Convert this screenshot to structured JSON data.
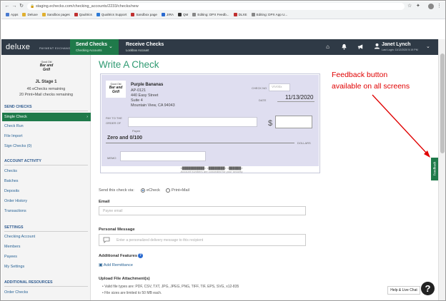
{
  "browser": {
    "url": "staging.echecks.com/checking_accounts/2233/checks/new",
    "bookmarks": [
      {
        "label": "Apps",
        "color": "#4a7bd0"
      },
      {
        "label": "Deluxe",
        "color": "#e0b030"
      },
      {
        "label": "Sandbox pages",
        "color": "#e0b030"
      },
      {
        "label": "Qaultrics",
        "color": "#c03030"
      },
      {
        "label": "Qualtrics Support",
        "color": "#2d7ad6"
      },
      {
        "label": "Sandbox page",
        "color": "#c03030"
      },
      {
        "label": "JIRA",
        "color": "#2a6ad0"
      },
      {
        "label": "QM",
        "color": "#333333"
      },
      {
        "label": "Editing: DPX Feedb...",
        "color": "#888888"
      },
      {
        "label": "DLXE",
        "color": "#c03030"
      },
      {
        "label": "Editing: DPX App U...",
        "color": "#888888"
      }
    ]
  },
  "header": {
    "logo": "deluxe",
    "logo_sub": "PAYMENT EXCHANGE",
    "send_title": "Send Checks",
    "send_sub": "Checking Accounts",
    "receive_title": "Receive Checks",
    "receive_sub": "Lockbox Account",
    "user_name": "Janet Lynch",
    "last_login": "Last Login: 11/12/2020 5:19 PM"
  },
  "sidebar": {
    "logo_top": "Good Old",
    "logo_main": "Bar and Grill",
    "stage": "JL Stage 1",
    "echecks": "46 eChecks remaining",
    "printmail": "20 Print+Mail checks remaining",
    "sections": {
      "send": "SEND CHECKS",
      "activity": "ACCOUNT ACTIVITY",
      "settings": "SETTINGS",
      "additional": "ADDITIONAL RESOURCES"
    },
    "send_items": [
      "Single Check",
      "Check Run",
      "File Import",
      "Sign Checks (0)"
    ],
    "activity_items": [
      "Checks",
      "Batches",
      "Deposits",
      "Order History",
      "Transactions"
    ],
    "settings_items": [
      "Checking Account",
      "Members",
      "Payees",
      "My Settings"
    ],
    "additional_items": [
      "Order Checks"
    ]
  },
  "main": {
    "title": "Write A Check",
    "payer_name": "Purple Bananas",
    "payer_lines": [
      "AP-0121",
      "440 Easy Street",
      "Suite 4",
      "Mountain View, CA 94043"
    ],
    "check_no_label": "CHECK NO",
    "check_no_placeholder": "VIV00x",
    "date_label": "DATE",
    "date_value": "11/13/2020",
    "pay_to_label_1": "PAY TO THE",
    "pay_to_label_2": "ORDER OF",
    "payee_label": "Payee",
    "dollar_sign": "$",
    "amount_words": "Zero and 0/100",
    "dollars_label": "DOLLARS",
    "memo_label": "MEMO",
    "footer_1": "<███████████> <████████> <██████>",
    "footer_2": "Account numbers are concealed for your security",
    "send_via_label": "Send this check via:",
    "option_echeck": "eCheck",
    "option_printmail": "Print+Mail",
    "email_label": "Email",
    "email_placeholder": "Payee email",
    "personal_message_label": "Personal Message",
    "message_placeholder": "Enter a personalized delivery message to this recipient",
    "additional_features_label": "Additional Features",
    "add_remittance": "Add Remittance",
    "upload_label": "Upload File Attachment(s)",
    "upload_bullets": [
      "Valid file types are: PDF, CSV, TXT, JPG, JPEG, PNG, TIFF, TIF, EPS, SVG, x12-835",
      "File sizes are limited to 50 MB each."
    ]
  },
  "feedback_label": "Feedback",
  "annotation": [
    "Feedback button",
    "available on all screens"
  ],
  "help_label": "Help & Live Chat",
  "help_icon": "?",
  "colors": {
    "brand_green": "#1f7a4a",
    "title_green": "#2f9a72",
    "header_dark": "#2f3a46",
    "annotation_red": "#e00000",
    "link_blue": "#2a6496"
  }
}
